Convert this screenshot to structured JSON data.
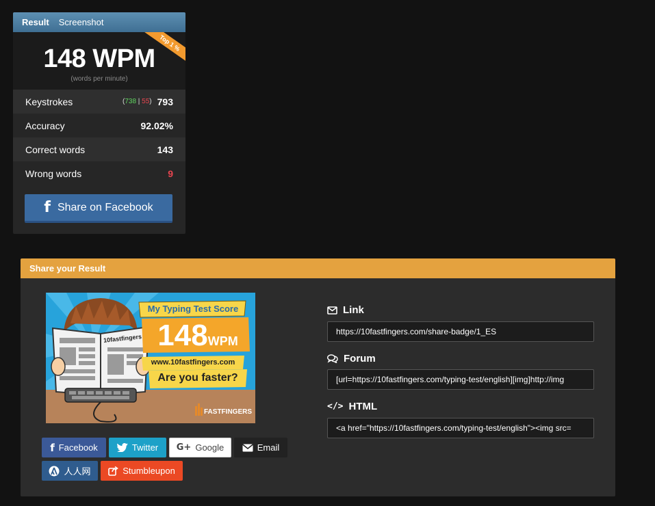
{
  "result_card": {
    "tabs": [
      "Result",
      "Screenshot"
    ],
    "ribbon": "Top 1 %",
    "wpm": "148 WPM",
    "wpm_sub": "(words per minute)",
    "keystrokes": {
      "label": "Keystrokes",
      "open": "(",
      "correct": "738",
      "sep": " | ",
      "wrong": "55",
      "close": ")",
      "value": "793"
    },
    "accuracy": {
      "label": "Accuracy",
      "value": "92.02%"
    },
    "correct_words": {
      "label": "Correct words",
      "value": "143"
    },
    "wrong_words": {
      "label": "Wrong words",
      "value": "9"
    },
    "share_facebook": "Share on Facebook"
  },
  "share_panel": {
    "title": "Share your Result",
    "badge": {
      "headline": "My Typing Test Score",
      "score": "148",
      "unit": "WPM",
      "site": "www.10fastfingers.com",
      "question": "Are you faster?",
      "paper_title": "10fastfingers",
      "logo": "FASTFINGERS"
    },
    "buttons": {
      "facebook": "Facebook",
      "twitter": "Twitter",
      "google": "Google",
      "email": "Email",
      "renren": "人人网",
      "stumbleupon": "Stumbleupon"
    },
    "link": {
      "label": "Link",
      "value": "https://10fastfingers.com/share-badge/1_ES"
    },
    "forum": {
      "label": "Forum",
      "value": "[url=https://10fastfingers.com/typing-test/english][img]http://img"
    },
    "html": {
      "label": "HTML",
      "value": "<a href=\"https://10fastfingers.com/typing-test/english\"><img src="
    }
  },
  "colors": {
    "card_header": "#4a7ea3",
    "share_header": "#e4a23f",
    "facebook": "#3b5998",
    "twitter": "#1da1c8",
    "stumbleupon": "#eb4924",
    "ribbon": "#f29a2e",
    "wrong": "#e8454f",
    "correct": "#5fd65f"
  }
}
